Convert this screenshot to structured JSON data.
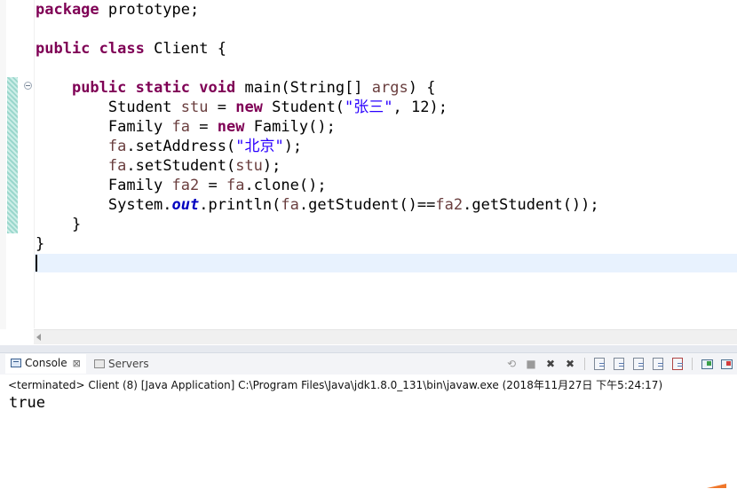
{
  "editor": {
    "code_lines": [
      [
        {
          "t": "package",
          "c": "kw"
        },
        {
          "t": " prototype;",
          "c": "plain"
        }
      ],
      [],
      [
        {
          "t": "public",
          "c": "kw"
        },
        {
          "t": " ",
          "c": "plain"
        },
        {
          "t": "class",
          "c": "kw"
        },
        {
          "t": " Client {",
          "c": "plain"
        }
      ],
      [],
      [
        {
          "t": "    ",
          "c": "plain"
        },
        {
          "t": "public",
          "c": "kw"
        },
        {
          "t": " ",
          "c": "plain"
        },
        {
          "t": "static",
          "c": "kw"
        },
        {
          "t": " ",
          "c": "plain"
        },
        {
          "t": "void",
          "c": "kw"
        },
        {
          "t": " main(String[] ",
          "c": "plain"
        },
        {
          "t": "args",
          "c": "var"
        },
        {
          "t": ") {",
          "c": "plain"
        }
      ],
      [
        {
          "t": "        Student ",
          "c": "plain"
        },
        {
          "t": "stu",
          "c": "var"
        },
        {
          "t": " = ",
          "c": "plain"
        },
        {
          "t": "new",
          "c": "kw"
        },
        {
          "t": " Student(",
          "c": "plain"
        },
        {
          "t": "\"张三\"",
          "c": "str"
        },
        {
          "t": ", 12);",
          "c": "plain"
        }
      ],
      [
        {
          "t": "        Family ",
          "c": "plain"
        },
        {
          "t": "fa",
          "c": "var"
        },
        {
          "t": " = ",
          "c": "plain"
        },
        {
          "t": "new",
          "c": "kw"
        },
        {
          "t": " Family();",
          "c": "plain"
        }
      ],
      [
        {
          "t": "        ",
          "c": "plain"
        },
        {
          "t": "fa",
          "c": "var"
        },
        {
          "t": ".setAddress(",
          "c": "plain"
        },
        {
          "t": "\"北京\"",
          "c": "str"
        },
        {
          "t": ");",
          "c": "plain"
        }
      ],
      [
        {
          "t": "        ",
          "c": "plain"
        },
        {
          "t": "fa",
          "c": "var"
        },
        {
          "t": ".setStudent(",
          "c": "plain"
        },
        {
          "t": "stu",
          "c": "var"
        },
        {
          "t": ");",
          "c": "plain"
        }
      ],
      [
        {
          "t": "        Family ",
          "c": "plain"
        },
        {
          "t": "fa2",
          "c": "var"
        },
        {
          "t": " = ",
          "c": "plain"
        },
        {
          "t": "fa",
          "c": "var"
        },
        {
          "t": ".clone();",
          "c": "plain"
        }
      ],
      [
        {
          "t": "        System.",
          "c": "plain"
        },
        {
          "t": "out",
          "c": "fld"
        },
        {
          "t": ".println(",
          "c": "plain"
        },
        {
          "t": "fa",
          "c": "var"
        },
        {
          "t": ".getStudent()==",
          "c": "plain"
        },
        {
          "t": "fa2",
          "c": "var"
        },
        {
          "t": ".getStudent());",
          "c": "plain"
        }
      ],
      [
        {
          "t": "    }",
          "c": "plain"
        }
      ],
      [
        {
          "t": "}",
          "c": "plain"
        }
      ],
      []
    ]
  },
  "console": {
    "tabs": [
      {
        "label": "Console",
        "close": "⊠"
      },
      {
        "label": "Servers"
      }
    ],
    "header": "<terminated> Client (8) [Java Application] C:\\Program Files\\Java\\jdk1.8.0_131\\bin\\javaw.exe (2018年11月27日 下午5:24:17)",
    "output": "true"
  },
  "toolbar_icons": [
    "terminate-relaunch-icon",
    "terminate-icon",
    "remove-launch-icon",
    "remove-all-terminated-icon",
    "clear-console-icon",
    "scroll-lock-icon",
    "word-wrap-icon",
    "show-on-output-icon",
    "show-on-error-icon",
    "pin-console-icon",
    "display-console-icon"
  ],
  "colors": {
    "keyword": "#7f0055",
    "string": "#2a00ff",
    "static_field": "#0000c0",
    "local_variable": "#6a3e3e",
    "current_line": "#e8f2fe"
  }
}
